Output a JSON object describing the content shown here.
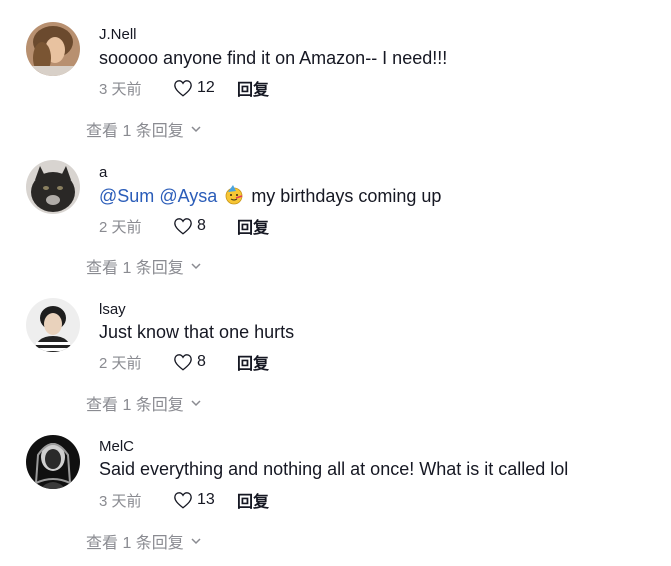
{
  "comments": [
    {
      "username": "J.Nell",
      "text": "sooooo anyone find it on Amazon-- I need!!!",
      "time": "3 天前",
      "likes": "12",
      "reply_label": "回复",
      "view_replies": "查看 1 条回复"
    },
    {
      "username": "a",
      "mentions": [
        "@Sum",
        "@Aysa"
      ],
      "emoji": "smiling-face-with-party-hat",
      "text": "my birthdays coming up",
      "time": "2 天前",
      "likes": "8",
      "reply_label": "回复",
      "view_replies": "查看 1 条回复"
    },
    {
      "username": "lsay",
      "text": "Just know that one hurts",
      "time": "2 天前",
      "likes": "8",
      "reply_label": "回复",
      "view_replies": "查看 1 条回复"
    },
    {
      "username": "MelC",
      "text": "Said everything and nothing all at once! What is it called lol",
      "time": "3 天前",
      "likes": "13",
      "reply_label": "回复",
      "view_replies": "查看 1 条回复"
    }
  ],
  "icons": {
    "like": "heart-outline-icon",
    "expand": "chevron-down-icon"
  },
  "colors": {
    "text": "#161823",
    "muted": "#8a8b91",
    "mention": "#2b5db9"
  }
}
